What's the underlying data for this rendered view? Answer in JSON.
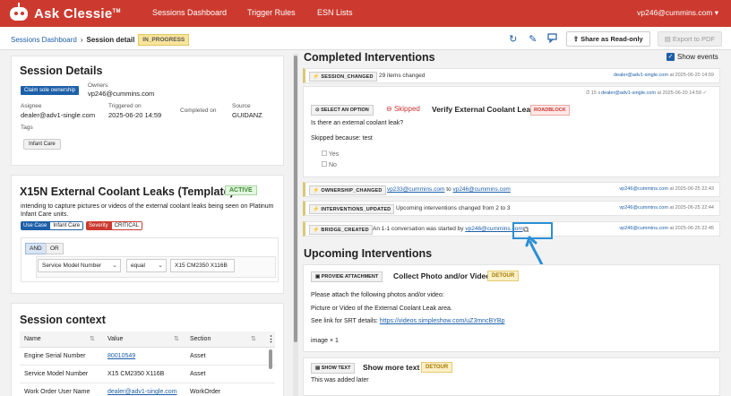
{
  "app": {
    "logo_text": "Ask Clessie",
    "logo_tm": "TM",
    "nav": [
      "Sessions Dashboard",
      "Trigger Rules",
      "ESN Lists"
    ],
    "user": "vp246@cummins.com"
  },
  "breadcrumb": {
    "parent": "Sessions Dashboard",
    "current": "Session detail",
    "status": "IN_PROGRESS"
  },
  "toolbar": {
    "share_label": "Share as Read-only",
    "export_label": "Export to PDF",
    "icons": [
      "refresh-icon",
      "pencil-icon",
      "chat-icon",
      "share-icon",
      "pdf-icon"
    ]
  },
  "session_details": {
    "title": "Session Details",
    "claim_label": "Claim sole ownership",
    "owners_label": "Owners",
    "owner": "vp246@cummins.com",
    "assignee_label": "Asignee",
    "assignee": "dealer@adv1-single.com",
    "triggered_label": "Triggered on",
    "triggered": "2025-06-20 14:59",
    "completed_label": "Completed on",
    "completed": "",
    "source_label": "Source",
    "source": "GUIDANZ",
    "tags_label": "Tags",
    "tag": "Infant Care"
  },
  "template": {
    "title": "X15N External Coolant Leaks (Template)",
    "status": "ACTIVE",
    "description": "intending to capture pictures or videos of the external coolant leaks being seen on Platinum Infant Care units.",
    "use_case_key": "Use Case",
    "use_case_value": "Infant Care",
    "severity_key": "Severity",
    "severity_value": "CRITICAL",
    "logic_and": "AND",
    "logic_or": "OR",
    "rule": {
      "field": "Service Model Number",
      "op": "equal",
      "value": "X15 CM2350 X116B"
    }
  },
  "session_context": {
    "title": "Session context",
    "columns": [
      "Name",
      "Value",
      "Section"
    ],
    "rows": [
      {
        "name": "Engine Serial Number",
        "value": "80010549",
        "section": "Asset"
      },
      {
        "name": "Service Model Number",
        "value": "X15 CM2350 X116B",
        "section": "Asset"
      },
      {
        "name": "Work Order User Name",
        "value": "dealer@adv1-single.com",
        "section": "WorkOrder"
      }
    ]
  },
  "completed": {
    "title": "Completed Interventions",
    "show_events": "Show events",
    "session_changed": {
      "chip": "SESSION_CHANGED",
      "desc": "29 items changed",
      "user": "dealer@adv1-single.com",
      "at": "at 2025-06-20 14:59"
    },
    "intervention": {
      "chip": "SELECT AN OPTION",
      "skipped": "Skipped",
      "title": "Verify External Coolant Leak",
      "badge": "ROADBLOCK",
      "duration": "15 s",
      "user": "dealer@adv1-single.com",
      "at": "at 2025-06-20 14:59",
      "question": "Is there an external coolant leak?",
      "skip_reason": "Skipped because: test",
      "options": [
        "Yes",
        "No"
      ]
    },
    "ownership_changed": {
      "chip": "OWNERSHIP_CHANGED",
      "from": "vp233@cummins.com",
      "to_word": "to",
      "to": "vp246@cummins.com",
      "user": "vp246@cummins.com",
      "at": "at 2025-06-25 22:43"
    },
    "interventions_updated": {
      "chip": "INTERVENTIONS_UPDATED",
      "desc": "Upcoming interventions changed from 2 to 3",
      "user": "vp246@cummins.com",
      "at": "at 2025-06-25 22:44"
    },
    "bridge_created": {
      "chip": "BRIDGE_CREATED",
      "desc": "An 1-1 conversation was started by",
      "by": "vp246@cummins.com",
      "user": "vp246@cummins.com",
      "at": "at 2025-06-25 22:45"
    }
  },
  "upcoming": {
    "title": "Upcoming Interventions",
    "attachment": {
      "chip": "PROVIDE ATTACHMENT",
      "title": "Collect Photo and/or Video",
      "badge": "DETOUR",
      "line1": "Please attach the following photos and/or video:",
      "line2": "Picture or Video of the External Coolant Leak area.",
      "line3_prefix": "See link for SRT details:",
      "link": "https://videos.simpleshow.com/uZ3mncBYBp",
      "image_count": "image × 1"
    },
    "show_text": {
      "chip": "SHOW TEXT",
      "title": "Show more text",
      "badge": "DETOUR",
      "body": "This was added later"
    }
  }
}
